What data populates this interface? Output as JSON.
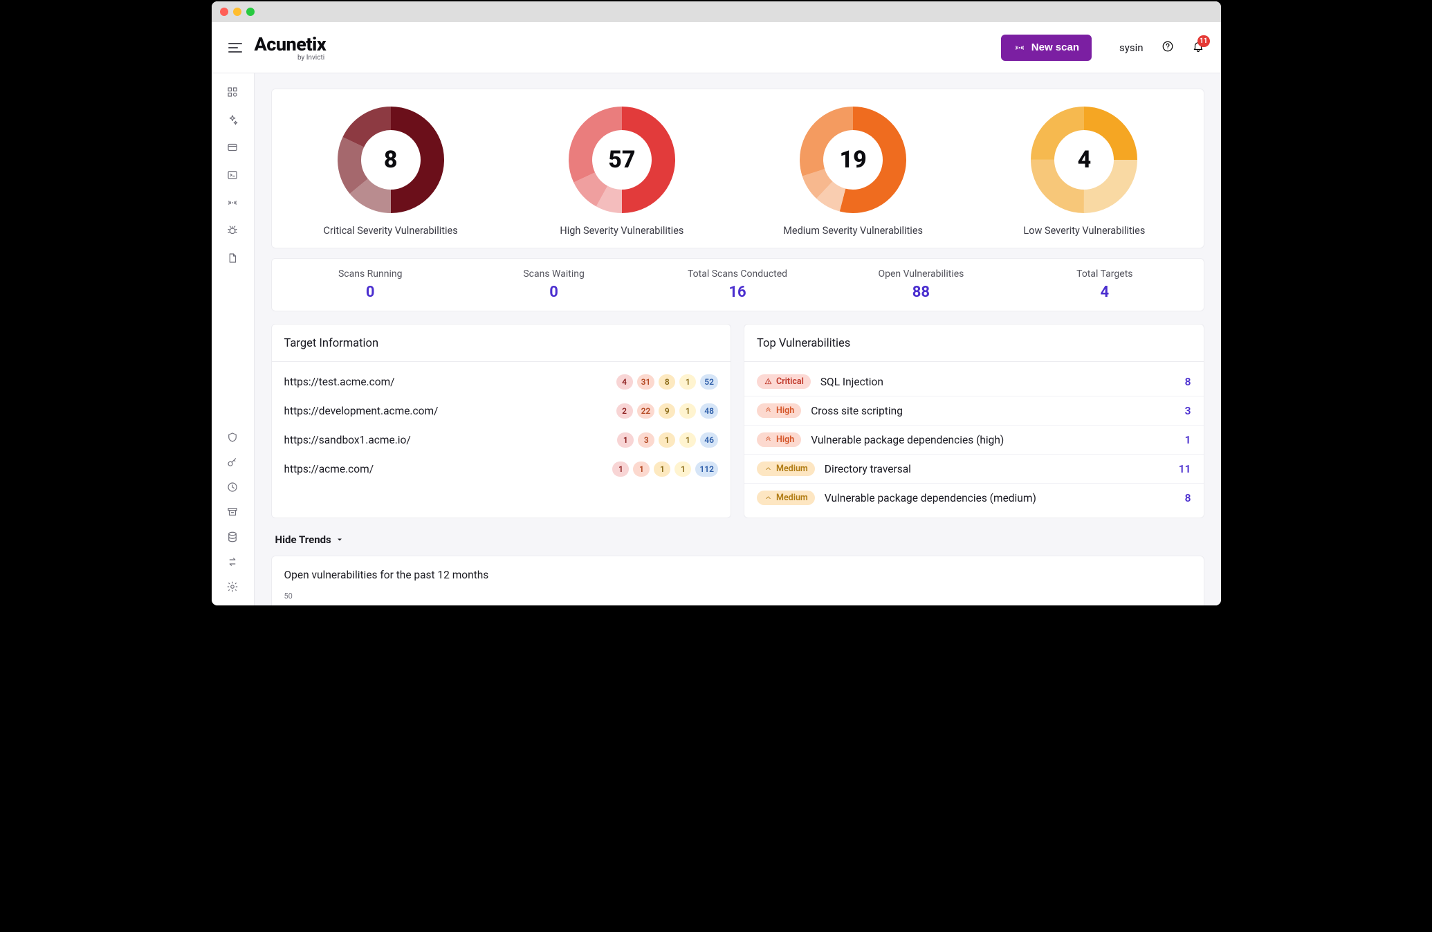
{
  "brand": {
    "name": "Acunetix",
    "sub": "by Invicti"
  },
  "topbar": {
    "new_scan": "New scan",
    "user": "sysin",
    "notif_count": "11"
  },
  "donuts": [
    {
      "value": "8",
      "label": "Critical Severity Vulnerabilities",
      "segments": [
        50,
        14,
        18,
        18
      ],
      "colors": [
        "#6b0f1a",
        "#b98c8f",
        "#a5686d",
        "#8d3a42"
      ]
    },
    {
      "value": "57",
      "label": "High Severity Vulnerabilities",
      "segments": [
        50,
        8,
        10,
        32
      ],
      "colors": [
        "#e23b3b",
        "#f4bdbd",
        "#ef9f9f",
        "#ea7d7d"
      ]
    },
    {
      "value": "19",
      "label": "Medium Severity Vulnerabilities",
      "segments": [
        54,
        8,
        8,
        30
      ],
      "colors": [
        "#ef6c1f",
        "#f9cdb0",
        "#f7b88e",
        "#f49b60"
      ]
    },
    {
      "value": "4",
      "label": "Low Severity Vulnerabilities",
      "segments": [
        25,
        25,
        25,
        25
      ],
      "colors": [
        "#f5a623",
        "#f9d9a3",
        "#f7c779",
        "#f6b94f"
      ]
    }
  ],
  "stats": [
    {
      "label": "Scans Running",
      "value": "0"
    },
    {
      "label": "Scans Waiting",
      "value": "0"
    },
    {
      "label": "Total Scans Conducted",
      "value": "16"
    },
    {
      "label": "Open Vulnerabilities",
      "value": "88"
    },
    {
      "label": "Total Targets",
      "value": "4"
    }
  ],
  "target_info": {
    "title": "Target Information",
    "rows": [
      {
        "url": "https://test.acme.com/",
        "counts": [
          "4",
          "31",
          "8",
          "1",
          "52"
        ]
      },
      {
        "url": "https://development.acme.com/",
        "counts": [
          "2",
          "22",
          "9",
          "1",
          "48"
        ]
      },
      {
        "url": "https://sandbox1.acme.io/",
        "counts": [
          "1",
          "3",
          "1",
          "1",
          "46"
        ]
      },
      {
        "url": "https://acme.com/",
        "counts": [
          "1",
          "1",
          "1",
          "1",
          "112"
        ]
      }
    ]
  },
  "top_vulns": {
    "title": "Top Vulnerabilities",
    "rows": [
      {
        "sev": "Critical",
        "sev_class": "crit",
        "name": "SQL Injection",
        "count": "8"
      },
      {
        "sev": "High",
        "sev_class": "high",
        "name": "Cross site scripting",
        "count": "3"
      },
      {
        "sev": "High",
        "sev_class": "high",
        "name": "Vulnerable package dependencies (high)",
        "count": "1"
      },
      {
        "sev": "Medium",
        "sev_class": "med",
        "name": "Directory traversal",
        "count": "11"
      },
      {
        "sev": "Medium",
        "sev_class": "med",
        "name": "Vulnerable package dependencies (medium)",
        "count": "8"
      }
    ]
  },
  "trends": {
    "toggle": "Hide Trends",
    "chart_title": "Open vulnerabilities for the past 12 months",
    "ylabel": "50"
  },
  "chart_data": [
    {
      "type": "pie",
      "title": "Critical Severity Vulnerabilities",
      "total": 8,
      "values": [
        50,
        14,
        18,
        18
      ]
    },
    {
      "type": "pie",
      "title": "High Severity Vulnerabilities",
      "total": 57,
      "values": [
        50,
        8,
        10,
        32
      ]
    },
    {
      "type": "pie",
      "title": "Medium Severity Vulnerabilities",
      "total": 19,
      "values": [
        54,
        8,
        8,
        30
      ]
    },
    {
      "type": "pie",
      "title": "Low Severity Vulnerabilities",
      "total": 4,
      "values": [
        25,
        25,
        25,
        25
      ]
    },
    {
      "type": "line",
      "title": "Open vulnerabilities for the past 12 months",
      "ylim": [
        0,
        50
      ],
      "x": [],
      "values": []
    }
  ]
}
